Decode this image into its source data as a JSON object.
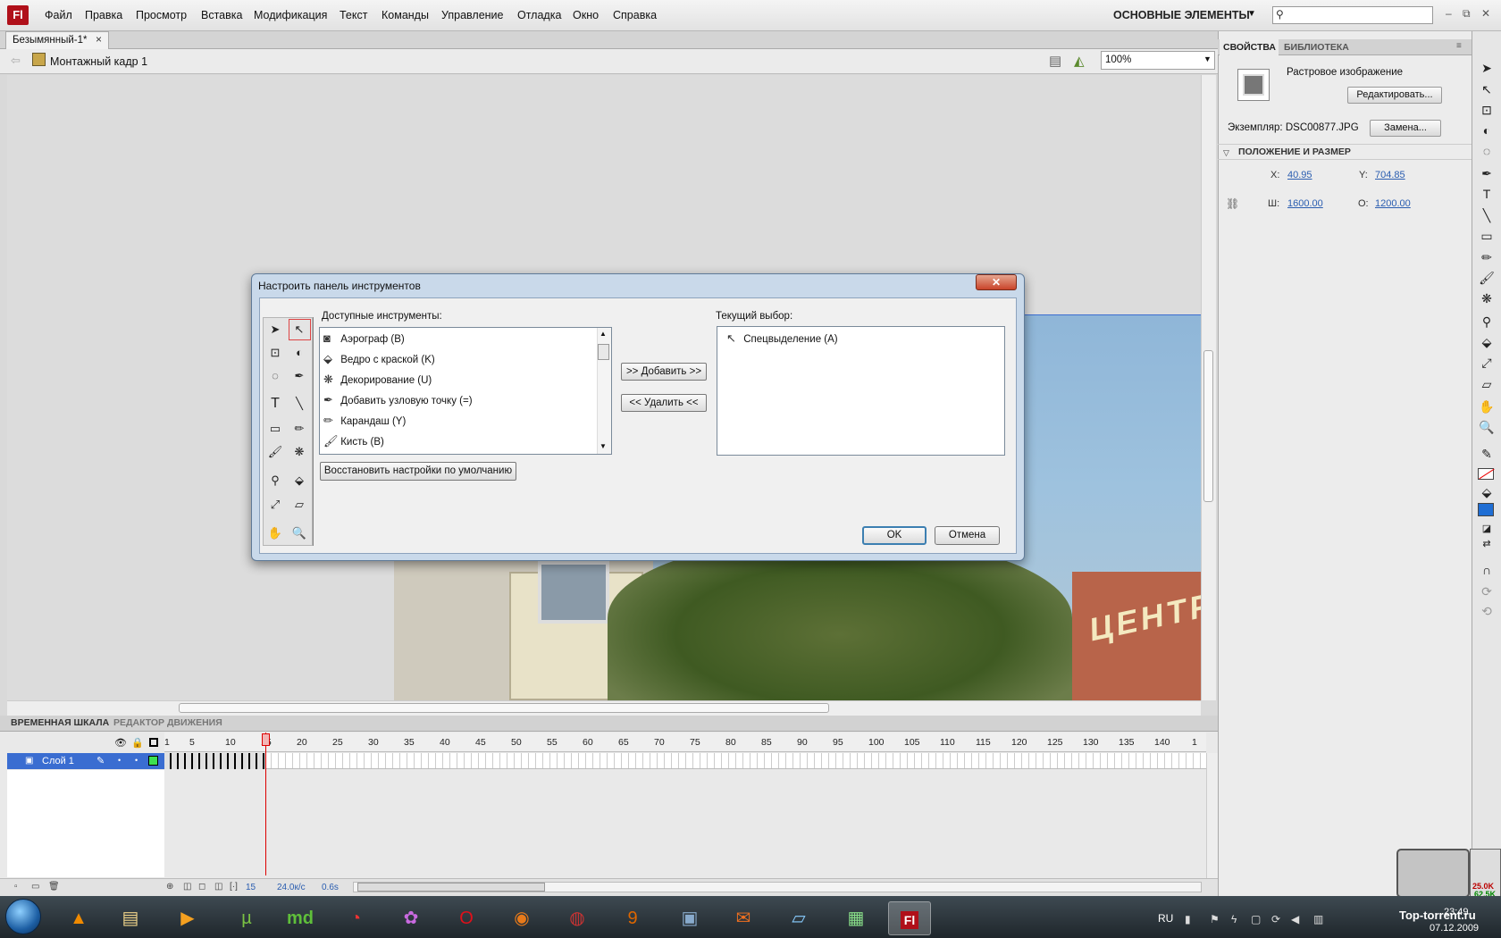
{
  "app": {
    "logo": "Fl"
  },
  "menu": [
    "Файл",
    "Правка",
    "Просмотр",
    "Вставка",
    "Модификация",
    "Текст",
    "Команды",
    "Управление",
    "Отладка",
    "Окно",
    "Справка"
  ],
  "workspace": {
    "label": "ОСНОВНЫЕ ЭЛЕМЕНТЫ"
  },
  "search": {
    "placeholder": ""
  },
  "window_controls": {
    "minimize": "–",
    "restore": "⧉",
    "close": "✕"
  },
  "document": {
    "tab_title": "Безымянный-1*",
    "scene": "Монтажный кадр 1",
    "zoom": "100%"
  },
  "stage": {
    "sign_text": "ЦЕНТР"
  },
  "timeline": {
    "tabs": [
      "ВРЕМЕННАЯ ШКАЛА",
      "РЕДАКТОР ДВИЖЕНИЯ"
    ],
    "ticks": [
      "1",
      "5",
      "10",
      "15",
      "20",
      "25",
      "30",
      "35",
      "40",
      "45",
      "50",
      "55",
      "60",
      "65",
      "70",
      "75",
      "80",
      "85",
      "90",
      "95",
      "100",
      "105",
      "110",
      "115",
      "120",
      "125",
      "130",
      "135",
      "140",
      "1"
    ],
    "layer_name": "Слой 1",
    "current_frame": "15",
    "fps": "24.0к/с",
    "time": "0.6s"
  },
  "properties": {
    "tabs": [
      "СВОЙСТВА",
      "БИБЛИОТЕКА"
    ],
    "object_type": "Растровое изображение",
    "edit_button": "Редактировать...",
    "instance_label": "Экземпляр:",
    "instance_value": "DSC00877.JPG",
    "swap_button": "Замена...",
    "section_title": "ПОЛОЖЕНИЕ И РАЗМЕР",
    "x_label": "X:",
    "x": "40.95",
    "y_label": "Y:",
    "y": "704.85",
    "w_label": "Ш:",
    "w": "1600.00",
    "h_label": "О:",
    "h": "1200.00"
  },
  "dialog": {
    "title": "Настроить панель инструментов",
    "close": "✕",
    "available_label": "Доступные инструменты:",
    "available_tools": [
      {
        "icon": "airbrush-icon",
        "label": "Аэрограф (B)"
      },
      {
        "icon": "paint-bucket-icon",
        "label": "Ведро с краской (K)"
      },
      {
        "icon": "deco-icon",
        "label": "Декорирование (U)"
      },
      {
        "icon": "add-anchor-icon",
        "label": "Добавить узловую точку (=)"
      },
      {
        "icon": "pencil-icon",
        "label": "Карандаш (Y)"
      },
      {
        "icon": "brush-icon",
        "label": "Кисть (B)"
      }
    ],
    "add_button": ">> Добавить >>",
    "remove_button": "<< Удалить <<",
    "current_label": "Текущий выбор:",
    "current_item": "Спецвыделение (A)",
    "restore_button": "Восстановить настройки по умолчанию",
    "ok_button": "OK",
    "cancel_button": "Отмена"
  },
  "taskbar": {
    "lang": "RU",
    "time": "23:49",
    "date": "07.12.2009",
    "watermark": "Top-torrent.ru",
    "net_up": "25.0K",
    "net_down": "62.5K",
    "apps": [
      "vlc-icon",
      "explorer-icon",
      "media-player-icon",
      "utorrent-icon",
      "md-icon",
      "chrome-icon",
      "picasa-icon",
      "opera-icon",
      "firefox-icon",
      "ie-icon",
      "nine-icon",
      "windows-explorer-icon",
      "mail-icon",
      "notepad-icon",
      "terminal-icon",
      "flash-icon"
    ]
  },
  "colors": {
    "accent": "#3a6dd1",
    "playhead": "#dd0000",
    "fill": "#1f6ed4",
    "flash_red": "#b0101a"
  }
}
